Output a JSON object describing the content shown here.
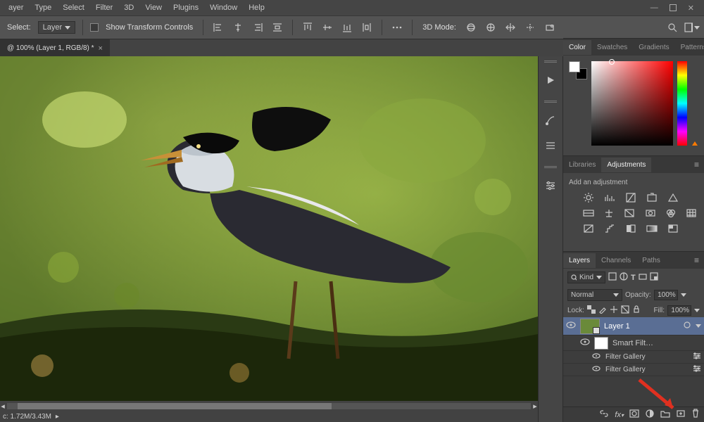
{
  "menu": {
    "items": [
      "ayer",
      "Type",
      "Select",
      "Filter",
      "3D",
      "View",
      "Plugins",
      "Window",
      "Help"
    ]
  },
  "optbar": {
    "auto_select_label": "Select:",
    "auto_select_value": "Layer",
    "show_transform": "Show Transform Controls",
    "mode_label": "3D Mode:"
  },
  "doc": {
    "tab_title": "@ 100% (Layer 1, RGB/8) *",
    "status": "c: 1.72M/3.43M"
  },
  "color_panel": {
    "tabs": [
      "Color",
      "Swatches",
      "Gradients",
      "Patterns"
    ]
  },
  "lib_panel": {
    "tabs": [
      "Libraries",
      "Adjustments"
    ],
    "title": "Add an adjustment"
  },
  "layers_panel": {
    "tabs": [
      "Layers",
      "Channels",
      "Paths"
    ],
    "filter": "Kind",
    "blend": "Normal",
    "opacity_label": "Opacity:",
    "opacity": "100%",
    "lock_label": "Lock:",
    "fill_label": "Fill:",
    "fill": "100%",
    "layer1": "Layer 1",
    "smart": "Smart Filt…",
    "fg1": "Filter Gallery",
    "fg2": "Filter Gallery"
  }
}
